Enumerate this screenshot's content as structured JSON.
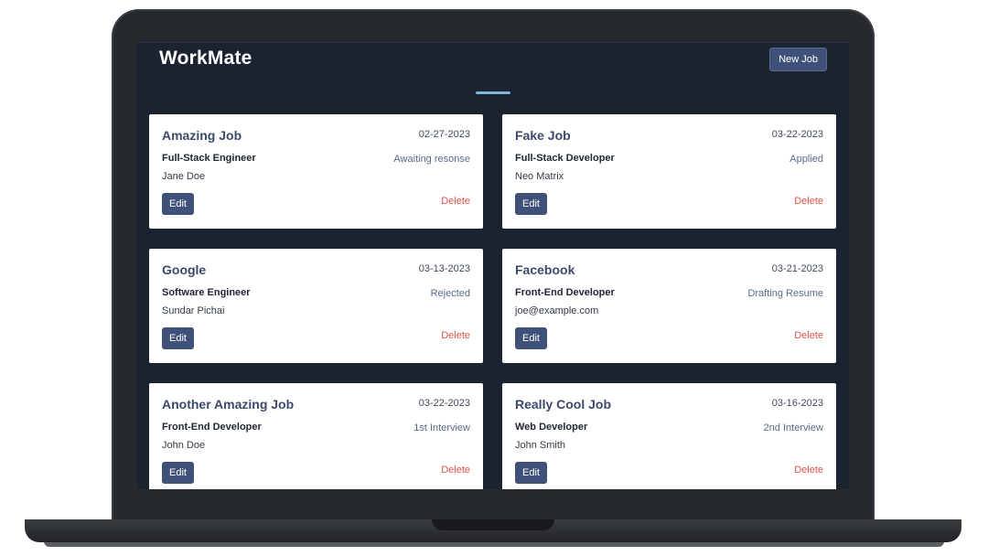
{
  "app": {
    "title": "WorkMate",
    "new_job_label": "New Job",
    "accent_color": "#7fb3d8",
    "brand_color": "#3f5178",
    "delete_color": "#e0534a"
  },
  "jobs": [
    {
      "company": "Amazing Job",
      "date": "02-27-2023",
      "role": "Full-Stack Engineer",
      "status": "Awaiting resonse",
      "contact": "Jane Doe",
      "edit_label": "Edit",
      "delete_label": "Delete"
    },
    {
      "company": "Fake Job",
      "date": "03-22-2023",
      "role": "Full-Stack Developer",
      "status": "Applied",
      "contact": "Neo Matrix",
      "edit_label": "Edit",
      "delete_label": "Delete"
    },
    {
      "company": "Google",
      "date": "03-13-2023",
      "role": "Software Engineer",
      "status": "Rejected",
      "contact": "Sundar Pichai",
      "edit_label": "Edit",
      "delete_label": "Delete"
    },
    {
      "company": "Facebook",
      "date": "03-21-2023",
      "role": "Front-End Developer",
      "status": "Drafting Resume",
      "contact": "joe@example.com",
      "edit_label": "Edit",
      "delete_label": "Delete"
    },
    {
      "company": "Another Amazing Job",
      "date": "03-22-2023",
      "role": "Front-End Developer",
      "status": "1st Interview",
      "contact": "John Doe",
      "edit_label": "Edit",
      "delete_label": "Delete"
    },
    {
      "company": "Really Cool Job",
      "date": "03-16-2023",
      "role": "Web Developer",
      "status": "2nd Interview",
      "contact": "John Smith",
      "edit_label": "Edit",
      "delete_label": "Delete"
    }
  ]
}
